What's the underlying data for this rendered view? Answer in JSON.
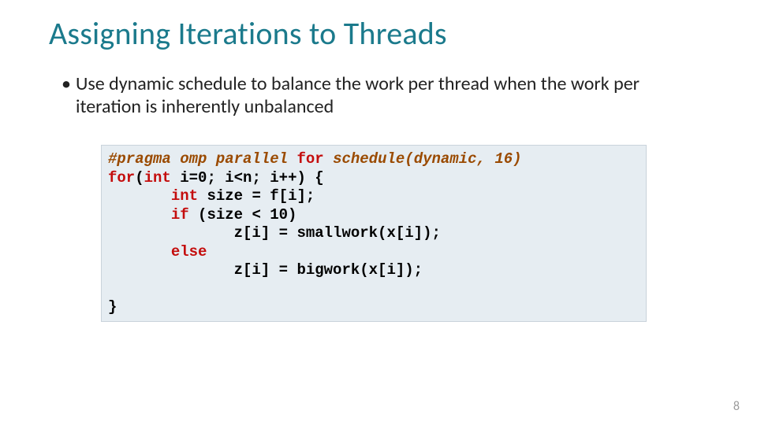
{
  "title": "Assigning Iterations to Threads",
  "bullet": {
    "marker": "•",
    "text": "Use dynamic schedule to balance the work per thread when the work per iteration is inherently unbalanced"
  },
  "code": {
    "l1a": "#pragma omp parallel ",
    "l1b": "for",
    "l1c": " schedule(dynamic",
    "l1d": ", 16)",
    "l2a": "for",
    "l2b": "(",
    "l2c": "int",
    "l2d": " i=0; i<n; i++) {",
    "l3a": "       ",
    "l3b": "int",
    "l3c": " size = f[i];",
    "l4a": "       ",
    "l4b": "if",
    "l4c": " (size < 10)",
    "l5": "              z[i] = smallwork(x[i]);",
    "l6a": "       ",
    "l6b": "else",
    "l7": "              z[i] = bigwork(x[i]);",
    "l8": "",
    "l9": "}"
  },
  "slide_number": "8"
}
